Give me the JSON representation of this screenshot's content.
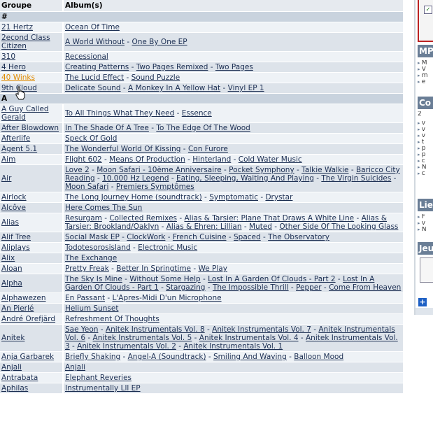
{
  "table": {
    "header": {
      "group": "Groupe",
      "albums": "Album(s)"
    },
    "hover_row": "40 Winks",
    "sections": [
      {
        "letter": "#",
        "rows": [
          {
            "group": "21 Hertz",
            "albums": [
              "Ocean Of Time"
            ]
          },
          {
            "group": "2econd Class Citizen",
            "albums": [
              "A World Without",
              "One By One EP"
            ]
          },
          {
            "group": "310",
            "albums": [
              "Recessional"
            ]
          },
          {
            "group": "4 Hero",
            "albums": [
              "Creating Patterns",
              "Two Pages Remixed",
              "Two Pages"
            ]
          },
          {
            "group": "40 Winks",
            "albums": [
              "The Lucid Effect",
              "Sound Puzzle"
            ]
          },
          {
            "group": "9th Cloud",
            "albums": [
              "Delicate Sound",
              "A Monkey In A Yellow Hat",
              "Vinyl EP 1"
            ]
          }
        ]
      },
      {
        "letter": "A",
        "rows": [
          {
            "group": "A Guy Called Gerald",
            "albums": [
              "To All Things What They Need",
              "Essence"
            ]
          },
          {
            "group": "After Blowdown",
            "albums": [
              "In The Shade Of A Tree",
              "To The Edge Of The Wood"
            ]
          },
          {
            "group": "Afterlife",
            "albums": [
              "Speck Of Gold"
            ]
          },
          {
            "group": "Agent 5.1",
            "albums": [
              "The Wonderful World Of Kissing",
              "Con Furore"
            ]
          },
          {
            "group": "Aim",
            "albums": [
              "Flight 602",
              "Means Of Production",
              "Hinterland",
              "Cold Water Music"
            ]
          },
          {
            "group": "Air",
            "albums": [
              "Love 2",
              "Moon Safari - 10ème Anniversaire",
              "Pocket Symphony",
              "Talkie Walkie",
              "Baricco City Reading",
              "10.000 Hz Legend",
              "Eating, Sleeping, Waiting And Playing",
              "The Virgin Suicides",
              "Moon Safari",
              "Premiers Symptômes"
            ]
          },
          {
            "group": "Airlock",
            "albums": [
              "The Long Journey Home (soundtrack)",
              "Symptomatic",
              "Drystar"
            ]
          },
          {
            "group": "Alcôve",
            "albums": [
              "Here Comes The Sun"
            ]
          },
          {
            "group": "Alias",
            "albums": [
              "Resurgam",
              "Collected Remixes",
              "Alias & Tarsier: Plane That Draws A White Line",
              "Alias & Tarsier: Brookland/Oaklyn",
              "Alias & Ehren: Lillian",
              "Muted",
              "Other Side Of The Looking Glass"
            ]
          },
          {
            "group": "Alif Tree",
            "albums": [
              "Social Mask EP",
              "ClockWork",
              "French Cuisine",
              "Spaced",
              "The Observatory"
            ]
          },
          {
            "group": "Aliplays",
            "albums": [
              "Todotesorosisland",
              "Electronic Music"
            ]
          },
          {
            "group": "Alix",
            "albums": [
              "The Exchange"
            ]
          },
          {
            "group": "Aloan",
            "albums": [
              "Pretty Freak",
              "Better In Springtime",
              "We Play"
            ]
          },
          {
            "group": "Alpha",
            "albums": [
              "The Sky Is Mine",
              "Without Some Help",
              "Lost In A Garden Of Clouds - Part 2",
              "Lost In A Garden Of Clouds - Part 1",
              "Stargazing",
              "The Impossible Thrill",
              "Pepper",
              "Come From Heaven"
            ]
          },
          {
            "group": "Alphawezen",
            "albums": [
              "En Passant",
              "L'Apres-Midi D'un Microphone"
            ]
          },
          {
            "group": "An Pierlé",
            "albums": [
              "Helium Sunset"
            ]
          },
          {
            "group": "André Orefjärd",
            "albums": [
              "Refreshment Of Thoughts"
            ]
          },
          {
            "group": "Anitek",
            "albums": [
              "Sae Yeon",
              "Anitek Instrumentals Vol. 8",
              "Anitek Instrumentals Vol. 7",
              "Anitek Instrumentals Vol. 6",
              "Anitek Instrumentals Vol. 5",
              "Anitek Instrumentals Vol. 4",
              "Anitek Instrumentals Vol. 3",
              "Anitek Instrumentals Vol. 2",
              "Anitek Instrumentals Vol. 1"
            ]
          },
          {
            "group": "Anja Garbarek",
            "albums": [
              "Briefly Shaking",
              "Angel-A (Soundtrack)",
              "Smiling And Waving",
              "Balloon Mood"
            ]
          },
          {
            "group": "Anjali",
            "albums": [
              "Anjali"
            ]
          },
          {
            "group": "Antrabata",
            "albums": [
              "Elephant Reveries"
            ]
          },
          {
            "group": "Aphilas",
            "albums": [
              "Instrumentally Lll EP"
            ]
          }
        ]
      }
    ]
  },
  "sidebar": {
    "headings": [
      "MP",
      "Co",
      "Lie",
      "Jeu"
    ],
    "checkbox_mark": "✓",
    "mp_items": [
      "M",
      "V",
      "m",
      "e"
    ],
    "co_count": "2",
    "co_items": [
      "v",
      "v",
      "v",
      "t",
      "p",
      "p",
      "c",
      "N",
      "c"
    ],
    "lie_items": [
      "F",
      "v",
      "N"
    ],
    "plus": "+"
  },
  "colors": {
    "link": "#1b2e52",
    "hover_link": "#e08a00",
    "header_bg": "#e6eaef",
    "letter_bg": "#c9d3de",
    "row_odd": "#eef2f6",
    "row_even": "#dde3ea",
    "side_heading": "#6a7e96"
  }
}
